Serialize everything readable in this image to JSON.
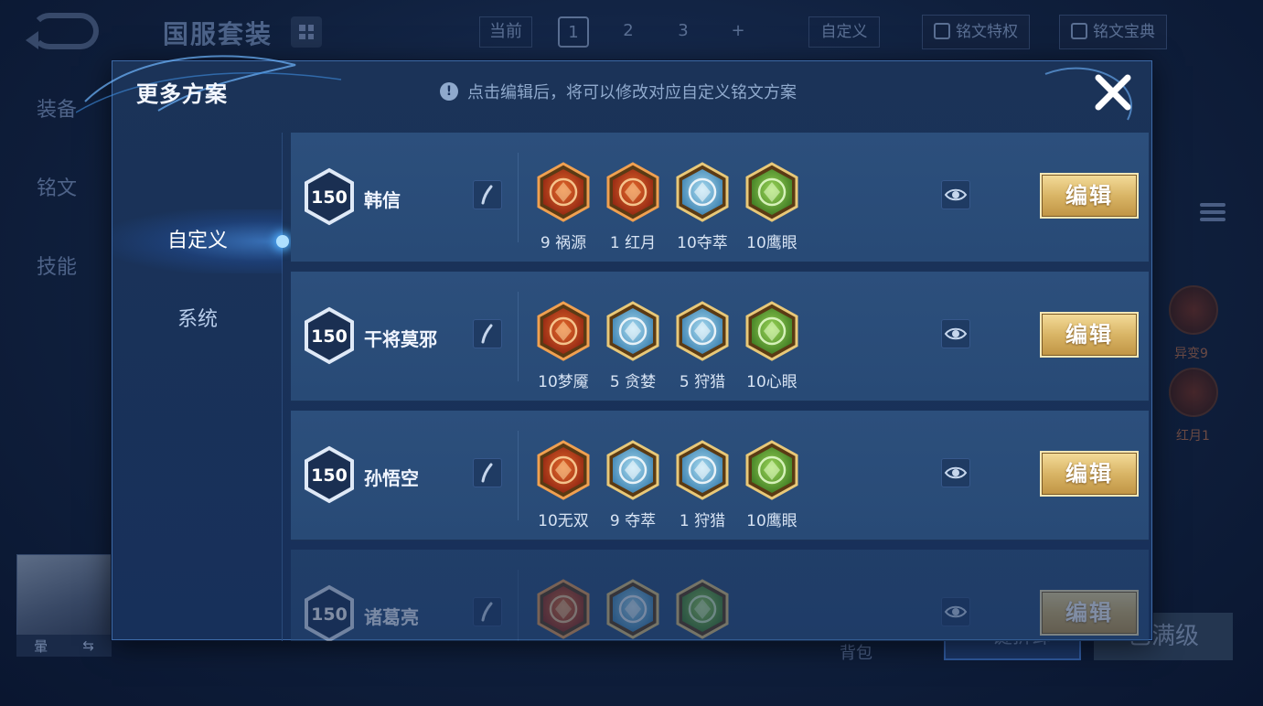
{
  "background": {
    "title": "国服套装",
    "current_label": "当前",
    "slots": [
      "1",
      "2",
      "3",
      "+"
    ],
    "custom_label": "自定义",
    "privilege_label": "铭文特权",
    "treasure_label": "铭文宝典",
    "side_nav": [
      "装备",
      "铭文",
      "技能"
    ],
    "avatar_bar": [
      "暈",
      "⇆"
    ],
    "side_runes": [
      "异变9",
      "红月1"
    ],
    "bottom_text": "背包",
    "quick_button": "一键拆卸",
    "max_button": "已满级"
  },
  "modal": {
    "title": "更多方案",
    "hint": "点击编辑后，将可以修改对应自定义铭文方案",
    "hint_icon": "!",
    "tabs": [
      "自定义",
      "系统"
    ],
    "edit_label": "编辑",
    "rows": [
      {
        "level": "150",
        "hero": "韩信",
        "runes": [
          {
            "label": "9 祸源",
            "color": "red"
          },
          {
            "label": "1 红月",
            "color": "red"
          },
          {
            "label": "10夺萃",
            "color": "blue"
          },
          {
            "label": "10鹰眼",
            "color": "green"
          }
        ]
      },
      {
        "level": "150",
        "hero": "干将莫邪",
        "runes": [
          {
            "label": "10梦魇",
            "color": "red"
          },
          {
            "label": "5 贪婪",
            "color": "blue"
          },
          {
            "label": "5 狩猎",
            "color": "blue"
          },
          {
            "label": "10心眼",
            "color": "green"
          }
        ]
      },
      {
        "level": "150",
        "hero": "孙悟空",
        "runes": [
          {
            "label": "10无双",
            "color": "red"
          },
          {
            "label": "9 夺萃",
            "color": "blue"
          },
          {
            "label": "1 狩猎",
            "color": "blue"
          },
          {
            "label": "10鹰眼",
            "color": "green"
          }
        ]
      },
      {
        "level": "150",
        "hero": "诸葛亮",
        "runes": [
          {
            "label": "",
            "color": "red"
          },
          {
            "label": "",
            "color": "blue"
          },
          {
            "label": "",
            "color": "green"
          }
        ]
      }
    ]
  },
  "colors": {
    "accent_gold": "#d9b566",
    "panel_bg": "#17305a",
    "row_bg": "#2c4f7c",
    "rune_red": "#c8451e",
    "rune_blue": "#7fb6d8",
    "rune_green": "#6aa83a"
  }
}
